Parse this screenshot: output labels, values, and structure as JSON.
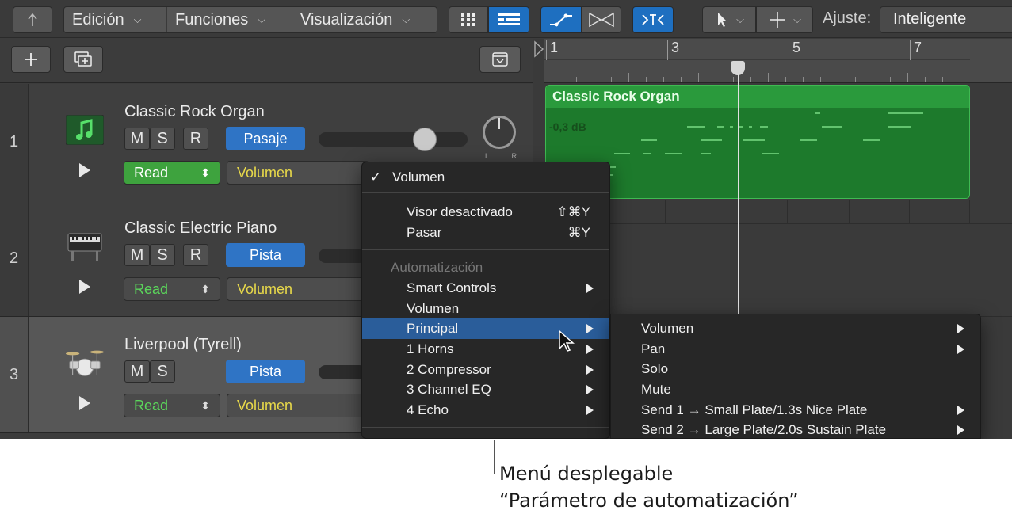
{
  "toolbar": {
    "back_icon": "back-arrow-icon",
    "menus": [
      "Edición",
      "Funciones",
      "Visualización"
    ],
    "snap_label": "Ajuste:",
    "snap_value": "Inteligente"
  },
  "tracks": [
    {
      "number": "1",
      "name": "Classic Rock Organ",
      "mute": "M",
      "solo": "S",
      "record": "R",
      "group": "Pasaje",
      "mode": "Read",
      "param": "Volumen",
      "pan_l": "L",
      "pan_r": "R"
    },
    {
      "number": "2",
      "name": "Classic Electric Piano",
      "mute": "M",
      "solo": "S",
      "record": "R",
      "group": "Pista",
      "mode": "Read",
      "param": "Volumen"
    },
    {
      "number": "3",
      "name": "Liverpool (Tyrell)",
      "mute": "M",
      "solo": "S",
      "group": "Pista",
      "mode": "Read",
      "param": "Volumen"
    }
  ],
  "ruler": {
    "bars": [
      "1",
      "3",
      "5",
      "7"
    ]
  },
  "region": {
    "name": "Classic Rock Organ",
    "level": "-0,3 dB"
  },
  "main_menu": {
    "checked": "Volumen",
    "items": [
      {
        "label": "Visor desactivado",
        "shortcut": "⇧⌘Y"
      },
      {
        "label": "Pasar",
        "shortcut": "⌘Y"
      }
    ],
    "section": "Automatización",
    "auto_items": [
      "Smart Controls",
      "Volumen",
      "Principal",
      "1 Horns",
      "2 Compressor",
      "3 Channel EQ",
      "4 Echo"
    ]
  },
  "sub_menu": {
    "items": [
      "Volumen",
      "Pan",
      "Solo",
      "Mute",
      "Send 1 → Small Plate/1.3s Nice Plate",
      "Send 2 → Large Plate/2.0s Sustain Plate"
    ]
  },
  "caption": {
    "line1": "Menú desplegable",
    "line2": "“Parámetro de automatización”"
  },
  "colors": {
    "accent": "#2f74c5",
    "region": "#1d7a2c",
    "highlight": "#2a5d9a",
    "read_green": "#3ea33e"
  }
}
